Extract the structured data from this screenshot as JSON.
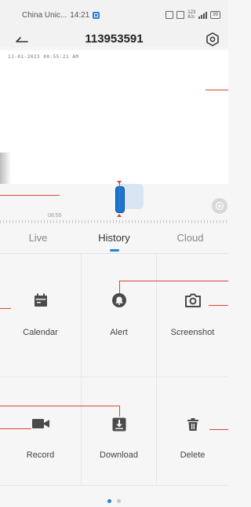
{
  "status_bar": {
    "carrier": "China Unic...",
    "time": "14:21",
    "speed_value": "123",
    "speed_unit": "K/s",
    "battery": "99"
  },
  "header": {
    "title": "113953591"
  },
  "video": {
    "timestamp": "11-01-2023 00:55:21 AM"
  },
  "timeline": {
    "time_label": "08:55"
  },
  "tabs": [
    {
      "label": "Live",
      "active": false
    },
    {
      "label": "History",
      "active": true
    },
    {
      "label": "Cloud",
      "active": false
    }
  ],
  "functions": [
    {
      "label": "Calendar",
      "icon": "calendar-icon"
    },
    {
      "label": "Alert",
      "icon": "alert-bell-icon"
    },
    {
      "label": "Screenshot",
      "icon": "camera-icon"
    },
    {
      "label": "Record",
      "icon": "video-camera-icon"
    },
    {
      "label": "Download",
      "icon": "download-icon"
    },
    {
      "label": "Delete",
      "icon": "trash-icon"
    }
  ],
  "pager": {
    "total": 2,
    "current": 1
  },
  "colors": {
    "accent": "#1f88d6",
    "annotation_line": "#d9472f",
    "icon": "#4a4a4a"
  }
}
